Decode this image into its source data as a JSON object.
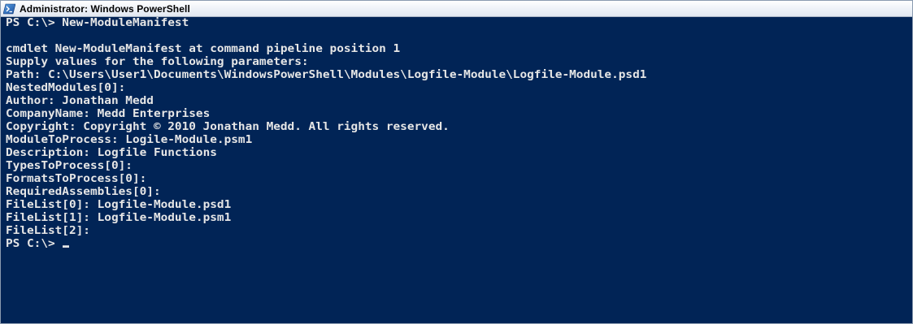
{
  "window": {
    "title": "Administrator: Windows PowerShell",
    "icon": "powershell-icon",
    "background_color": "#012456",
    "text_color": "#e6e6e6"
  },
  "console": {
    "lines": [
      "PS C:\\> New-ModuleManifest",
      "",
      "cmdlet New-ModuleManifest at command pipeline position 1",
      "Supply values for the following parameters:",
      "Path: C:\\Users\\User1\\Documents\\WindowsPowerShell\\Modules\\Logfile-Module\\Logfile-Module.psd1",
      "NestedModules[0]:",
      "Author: Jonathan Medd",
      "CompanyName: Medd Enterprises",
      "Copyright: Copyright © 2010 Jonathan Medd. All rights reserved.",
      "ModuleToProcess: Logile-Module.psm1",
      "Description: Logfile Functions",
      "TypesToProcess[0]:",
      "FormatsToProcess[0]:",
      "RequiredAssemblies[0]:",
      "FileList[0]: Logfile-Module.psd1",
      "FileList[1]: Logfile-Module.psm1",
      "FileList[2]:"
    ],
    "prompt": "PS C:\\> "
  }
}
